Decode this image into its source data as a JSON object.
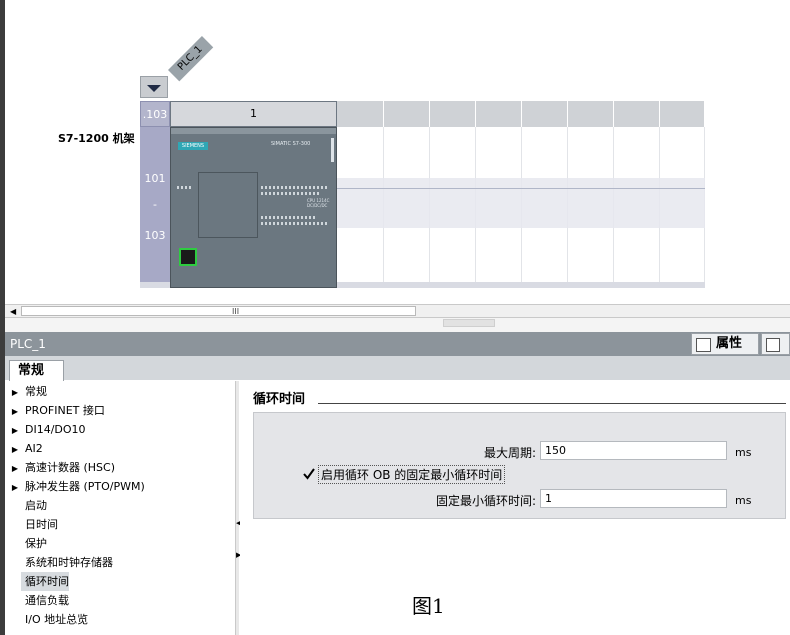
{
  "device_view": {
    "plc_tag": "PLC_1",
    "rack_label": "S7-1200 机架",
    "slot_side_labels": {
      "top": ".103",
      "mid1": "101",
      "mid2": "-",
      "mid3": "103"
    },
    "slot1_header": "1",
    "cpu": {
      "brand": "SIEMENS",
      "model": "SIMATIC S7-300",
      "type": "CPU 1214C DC/DC/DC"
    }
  },
  "scrollbar": {
    "grip": "III"
  },
  "inspector": {
    "title": "PLC_1",
    "tabs": {
      "properties": "属性"
    },
    "subtab_general": "常规",
    "nav": [
      {
        "label": "常规",
        "expandable": true
      },
      {
        "label": "PROFINET 接口",
        "expandable": true
      },
      {
        "label": "DI14/DO10",
        "expandable": true
      },
      {
        "label": "AI2",
        "expandable": true
      },
      {
        "label": "高速计数器 (HSC)",
        "expandable": true
      },
      {
        "label": "脉冲发生器 (PTO/PWM)",
        "expandable": true
      },
      {
        "label": "启动",
        "expandable": false
      },
      {
        "label": "日时间",
        "expandable": false
      },
      {
        "label": "保护",
        "expandable": false
      },
      {
        "label": "系统和时钟存储器",
        "expandable": false
      },
      {
        "label": "循环时间",
        "expandable": false,
        "selected": true
      },
      {
        "label": "通信负载",
        "expandable": false
      },
      {
        "label": "I/O 地址总览",
        "expandable": false
      }
    ],
    "section_title": "循环时间",
    "max_cycle_label": "最大周期:",
    "max_cycle_value": "150",
    "max_cycle_unit": "ms",
    "enable_min_label": "启用循环 OB 的固定最小循环时间",
    "enable_min_checked": true,
    "fixed_min_label": "固定最小循环时间:",
    "fixed_min_value": "1",
    "fixed_min_unit": "ms"
  },
  "figure_label": "图1",
  "colors": {
    "cpu_body": "#6b7780",
    "slot_side": "#a7a9c6",
    "title_bar": "#8c949b",
    "port_green": "#2ecc40"
  }
}
